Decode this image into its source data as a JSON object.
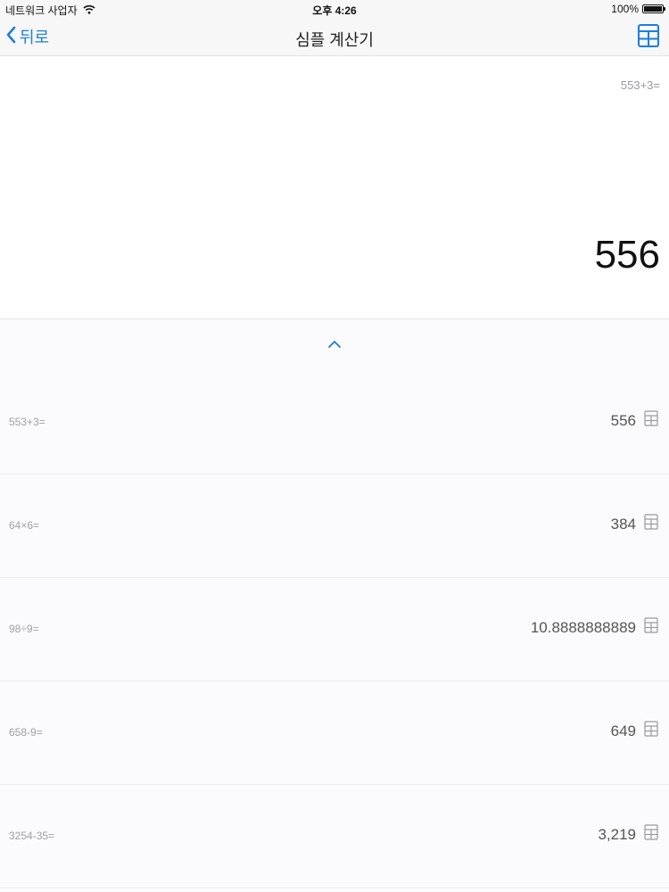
{
  "status_bar": {
    "carrier": "네트워크 사업자",
    "time": "오후 4:26",
    "battery": "100%",
    "battery_level": 1.0
  },
  "nav_bar": {
    "back_label": "뒤로",
    "title": "심플 계산기"
  },
  "display": {
    "expression": "553+3=",
    "result": "556"
  },
  "history": {
    "items": [
      {
        "expression": "553+3=",
        "result": "556"
      },
      {
        "expression": "64×6=",
        "result": "384"
      },
      {
        "expression": "98÷9=",
        "result": "10.8888888889"
      },
      {
        "expression": "658-9=",
        "result": "649"
      },
      {
        "expression": "3254-35=",
        "result": "3,219"
      }
    ]
  },
  "colors": {
    "accent": "#1a7fe0",
    "nav_background": "#f7f7f7",
    "history_background": "#fbfbfd"
  },
  "icons": {
    "back": "chevron-left-icon",
    "calculator": "calculator-icon",
    "collapse": "chevron-up-icon",
    "wifi": "wifi-icon",
    "battery": "battery-icon"
  }
}
